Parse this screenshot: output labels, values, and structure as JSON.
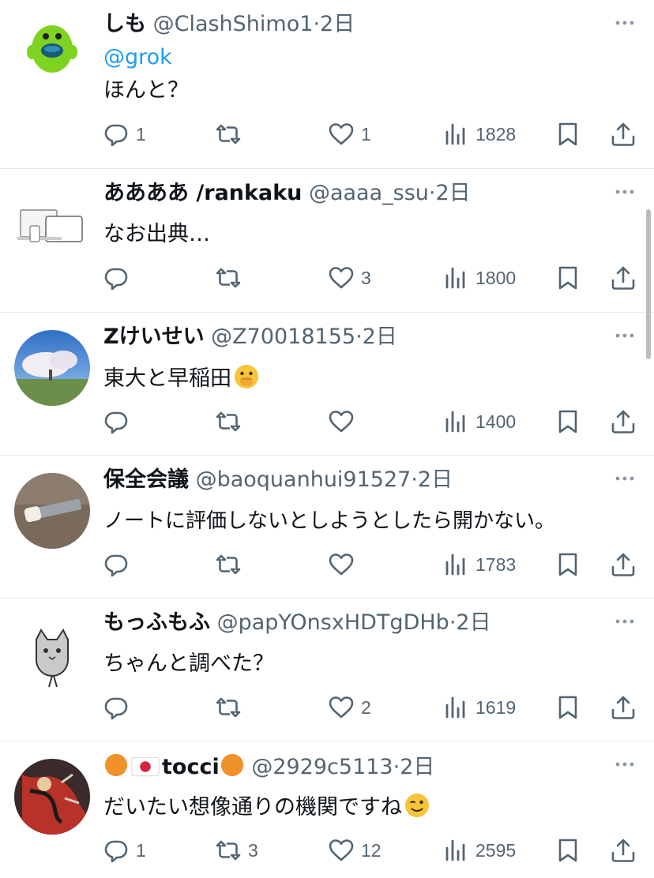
{
  "tweets": [
    {
      "name": "しも",
      "handle": "@ClashShimo1",
      "sep": "·",
      "time": "2日",
      "mention": "@grok",
      "text": "ほんと？",
      "replies": "1",
      "retweets": "",
      "likes": "1",
      "views": "1828"
    },
    {
      "name": "ああああ /rankaku",
      "handle": "@aaaa_ssu",
      "sep": "·",
      "time": "2日",
      "mention": "",
      "text": "なお出典…",
      "replies": "",
      "retweets": "",
      "likes": "3",
      "views": "1800"
    },
    {
      "name": "Zけいせい",
      "handle": "@Z70018155",
      "sep": "·",
      "time": "2日",
      "mention": "",
      "text": "東大と早稲田",
      "replies": "",
      "retweets": "",
      "likes": "",
      "views": "1400"
    },
    {
      "name": "保全会議",
      "handle": "@baoquanhui91527",
      "sep": "·",
      "time": "2日",
      "mention": "",
      "text": "ノートに評価しないとしようとしたら開かない。",
      "replies": "",
      "retweets": "",
      "likes": "",
      "views": "1783"
    },
    {
      "name": "もっふもふ",
      "handle": "@papYOnsxHDTgDHb",
      "sep": "·",
      "time": "2日",
      "mention": "",
      "text": "ちゃんと調べた？",
      "replies": "",
      "retweets": "",
      "likes": "2",
      "views": "1619"
    },
    {
      "name": "tocci",
      "handle": "@2929c5113",
      "sep": "·",
      "time": "2日",
      "mention": "",
      "text": "だいたい想像通りの機関ですね",
      "replies": "1",
      "retweets": "3",
      "likes": "12",
      "views": "2595"
    }
  ],
  "icons": {
    "reply": "reply-icon",
    "retweet": "retweet-icon",
    "like": "heart-icon",
    "views": "views-chart-icon",
    "bookmark": "bookmark-icon",
    "share": "share-icon",
    "more": "more-dots-icon"
  },
  "colors": {
    "accent": "#1d9bf0",
    "muted": "#536471",
    "divider": "#e6e8ea"
  }
}
